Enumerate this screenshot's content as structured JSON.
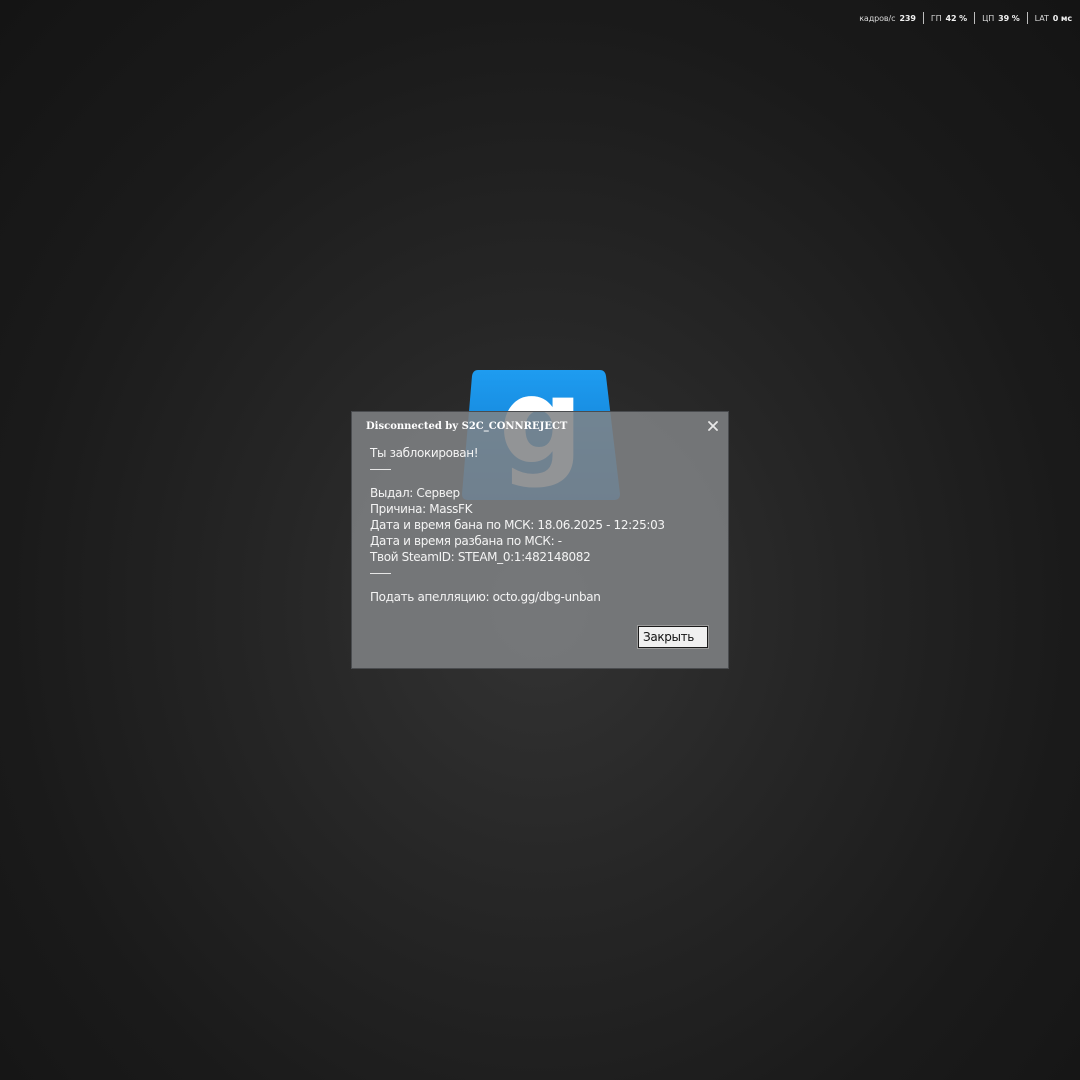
{
  "perf": {
    "fps_label": "кадров/с",
    "fps_value": "239",
    "gpu_label": "ГП",
    "gpu_value": "42 %",
    "cpu_label": "ЦП",
    "cpu_value": "39 %",
    "lat_label": "LAT",
    "lat_value": "0 мс"
  },
  "logo": {
    "letter": "g",
    "color": "#1a8fe3"
  },
  "dialog": {
    "title": "Disconnected by S2C_CONNREJECT",
    "close_icon": "close-icon",
    "blocked": "Ты заблокирован!",
    "issued_by": "Выдал: Сервер",
    "reason": "Причина: MassFK",
    "ban_time": "Дата и время бана по МСК: 18.06.2025 - 12:25:03",
    "unban_time": "Дата и время разбана по МСК: -",
    "steamid": "Твой SteamID: STEAM_0:1:482148082",
    "appeal": "Подать апелляцию: octo.gg/dbg-unban",
    "close_button": "Закрыть"
  }
}
